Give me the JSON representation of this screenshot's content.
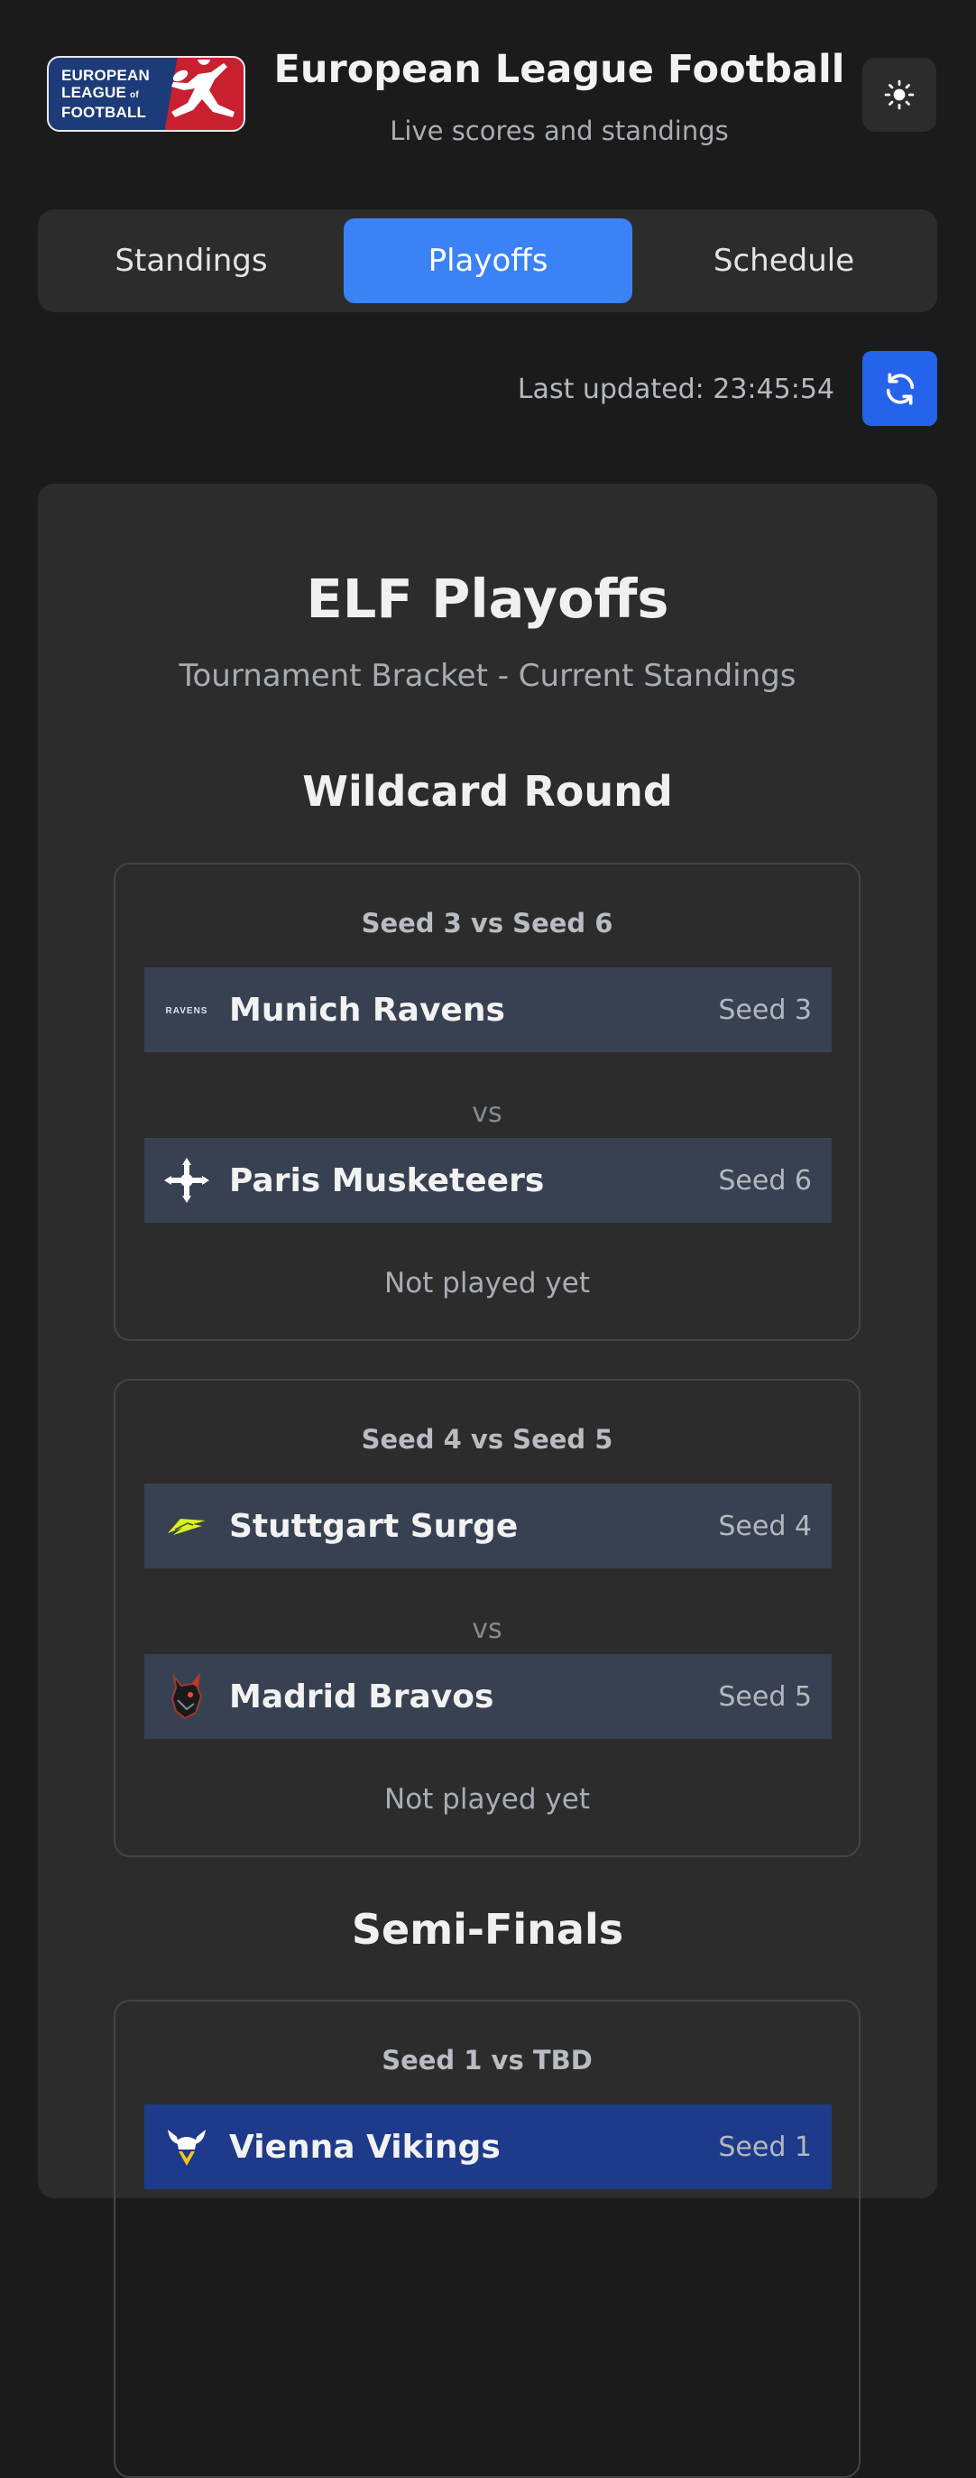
{
  "header": {
    "logo_lines": [
      "EUROPEAN",
      "LEAGUE",
      "of",
      "FOOTBALL"
    ],
    "title": "European League Football",
    "subtitle": "Live scores and standings",
    "theme_icon": "sun-icon"
  },
  "tabs": [
    {
      "label": "Standings",
      "active": false
    },
    {
      "label": "Playoffs",
      "active": true
    },
    {
      "label": "Schedule",
      "active": false
    }
  ],
  "status": {
    "last_updated": "Last updated: 23:45:54",
    "refresh_icon": "refresh-icon"
  },
  "playoffs": {
    "title": "ELF Playoffs",
    "subtitle": "Tournament Bracket - Current Standings",
    "rounds": [
      {
        "title": "Wildcard Round",
        "matches": [
          {
            "header": "Seed 3 vs Seed 6",
            "team1": {
              "name": "Munich Ravens",
              "seed": "Seed 3",
              "logo_text": "RAVENS"
            },
            "vs": "vs",
            "team2": {
              "name": "Paris Musketeers",
              "seed": "Seed 6"
            },
            "status": "Not played yet"
          },
          {
            "header": "Seed 4 vs Seed 5",
            "team1": {
              "name": "Stuttgart Surge",
              "seed": "Seed 4"
            },
            "vs": "vs",
            "team2": {
              "name": "Madrid Bravos",
              "seed": "Seed 5"
            },
            "status": "Not played yet"
          }
        ]
      },
      {
        "title": "Semi-Finals",
        "matches": [
          {
            "header": "Seed 1 vs TBD",
            "team1": {
              "name": "Vienna Vikings",
              "seed": "Seed 1"
            }
          }
        ]
      }
    ]
  },
  "colors": {
    "background": "#1b1b1b",
    "surface": "#2c2c2c",
    "accent": "#3b82f6",
    "team_row": "#374151",
    "team_row_highlight": "#1e3a8a"
  }
}
